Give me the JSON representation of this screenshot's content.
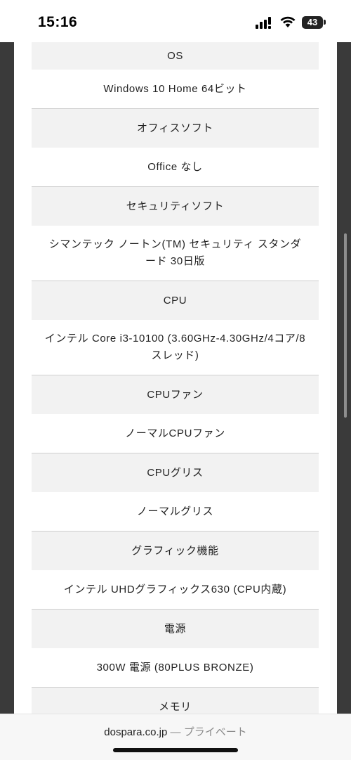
{
  "status_bar": {
    "time": "15:16",
    "battery_level": "43"
  },
  "specs": [
    {
      "label": "OS",
      "value": "Windows 10 Home 64ビット"
    },
    {
      "label": "オフィスソフト",
      "value": "Office なし"
    },
    {
      "label": "セキュリティソフト",
      "value": "シマンテック ノートン(TM) セキュリティ スタンダード 30日版"
    },
    {
      "label": "CPU",
      "value": "インテル Core i3-10100 (3.60GHz-4.30GHz/4コア/8スレッド)"
    },
    {
      "label": "CPUファン",
      "value": "ノーマルCPUファン"
    },
    {
      "label": "CPUグリス",
      "value": "ノーマルグリス"
    },
    {
      "label": "グラフィック機能",
      "value": "インテル UHDグラフィックス630 (CPU内蔵)"
    },
    {
      "label": "電源",
      "value": "300W 電源 (80PLUS BRONZE)"
    },
    {
      "label": "メモリ",
      "value": ""
    }
  ],
  "browser": {
    "domain": "dospara.co.jp",
    "separator": "—",
    "privacy_label": "プライベート"
  }
}
